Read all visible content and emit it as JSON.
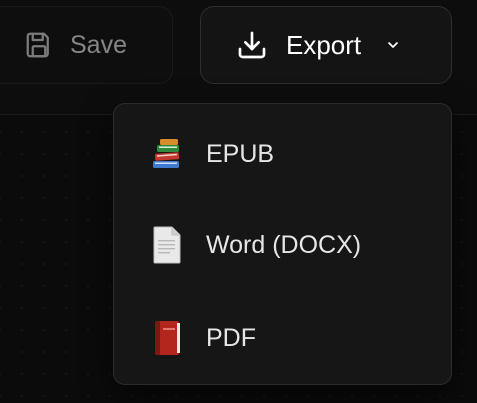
{
  "toolbar": {
    "save": {
      "label": "Save",
      "icon": "floppy-disk-icon",
      "disabled": true
    },
    "export": {
      "label": "Export",
      "icon": "download-icon",
      "chevron": "chevron-down-icon"
    }
  },
  "export_menu": {
    "items": [
      {
        "label": "EPUB",
        "icon": "books-icon"
      },
      {
        "label": "Word (DOCX)",
        "icon": "document-icon"
      },
      {
        "label": "PDF",
        "icon": "red-book-icon"
      }
    ]
  },
  "colors": {
    "background": "#0b0b0b",
    "menu_bg": "#161616",
    "text": "#e6e6e6"
  }
}
